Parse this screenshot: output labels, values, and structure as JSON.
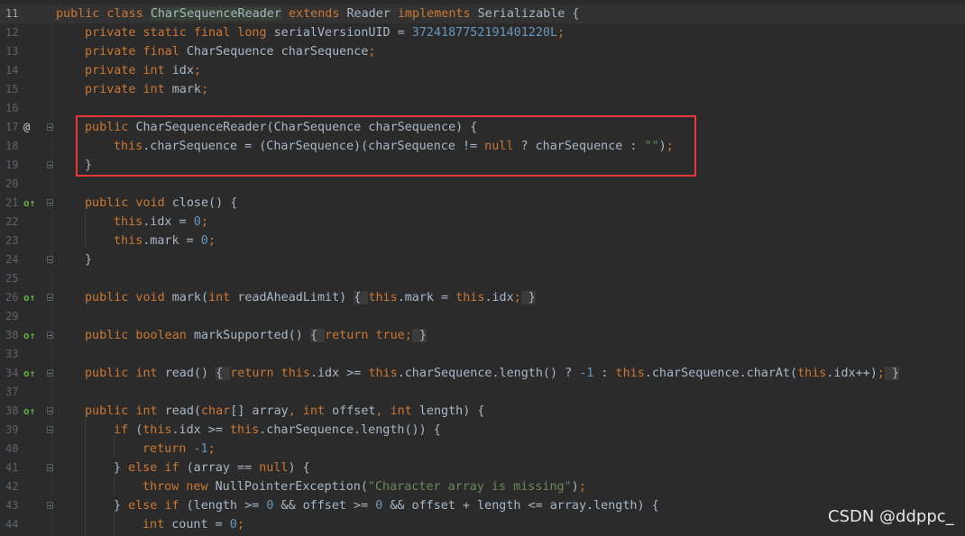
{
  "editor": {
    "line_numbers": [
      "11",
      "12",
      "13",
      "14",
      "15",
      "16",
      "17",
      "18",
      "19",
      "20",
      "21",
      "22",
      "23",
      "24",
      "25",
      "26",
      "29",
      "30",
      "33",
      "34",
      "37",
      "38",
      "39",
      "40",
      "41",
      "42",
      "43",
      "44"
    ],
    "gutter_marks": {
      "17": "@",
      "21": "o↑",
      "26": "o↑",
      "30": "o↑",
      "34": "o↑",
      "38": "o↑"
    },
    "line_11": {
      "t1": "public class ",
      "class_name": "CharSequenceReader",
      "t2": " extends ",
      "t3": "Reader ",
      "t4": "implements ",
      "t5": "Serializable {"
    },
    "line_12": {
      "t1": "private static final long ",
      "t2": "serialVersionUID = ",
      "t3": "3724187752191401220L",
      "t4": ";"
    },
    "line_13": {
      "t1": "private final ",
      "t2": "CharSequence charSequence",
      "t3": ";"
    },
    "line_14": {
      "t1": "private int ",
      "t2": "idx",
      "t3": ";"
    },
    "line_15": {
      "t1": "private int ",
      "t2": "mark",
      "t3": ";"
    },
    "line_17": {
      "t1": "public ",
      "t2": "CharSequenceReader(CharSequence charSequence) {"
    },
    "line_18": {
      "t1": "this",
      "t2": ".charSequence = (CharSequence)(charSequence != ",
      "t3": "null",
      "t4": " ? charSequence : ",
      "t5": "\"\"",
      "t6": ")",
      "t7": ";"
    },
    "line_19": {
      "t1": "}"
    },
    "line_21": {
      "t1": "public void ",
      "t2": "close() {"
    },
    "line_22": {
      "t1": "this",
      "t2": ".idx = ",
      "t3": "0",
      "t4": ";"
    },
    "line_23": {
      "t1": "this",
      "t2": ".mark = ",
      "t3": "0",
      "t4": ";"
    },
    "line_24": {
      "t1": "}"
    },
    "line_26": {
      "t1": "public void ",
      "t2": "mark(",
      "t3": "int ",
      "t4": "readAheadLimit) ",
      "t5": "{ ",
      "t6": "this",
      "t7": ".mark = ",
      "t8": "this",
      "t9": ".idx",
      "t10": ";",
      "t11": " }"
    },
    "line_30": {
      "t1": "public boolean ",
      "t2": "markSupported() ",
      "t3": "{ ",
      "t4": "return true",
      "t5": ";",
      "t6": " }"
    },
    "line_34": {
      "t1": "public int ",
      "t2": "read() ",
      "t3": "{ ",
      "t4": "return this",
      "t5": ".idx >= ",
      "t6": "this",
      "t7": ".charSequence.length() ? ",
      "t8": "-1",
      "t9": " : ",
      "t10": "this",
      "t11": ".charSequence.charAt(",
      "t12": "this",
      "t13": ".idx++)",
      "t14": ";",
      "t15": " }"
    },
    "line_38": {
      "t1": "public int ",
      "t2": "read(",
      "t3": "char",
      "t4": "[] array",
      "t5": ", ",
      "t6": "int ",
      "t7": "offset",
      "t8": ", ",
      "t9": "int ",
      "t10": "length) {"
    },
    "line_39": {
      "t1": "if ",
      "t2": "(",
      "t3": "this",
      "t4": ".idx >= ",
      "t5": "this",
      "t6": ".charSequence.length()) {"
    },
    "line_40": {
      "t1": "return ",
      "t2": "-1",
      "t3": ";"
    },
    "line_41": {
      "t1": "} ",
      "t2": "else if ",
      "t3": "(array == ",
      "t4": "null",
      "t5": ") {"
    },
    "line_42": {
      "t1": "throw new ",
      "t2": "NullPointerException(",
      "t3": "\"Character array is missing\"",
      "t4": ")",
      "t5": ";"
    },
    "line_43": {
      "t1": "} ",
      "t2": "else if ",
      "t3": "(length >= ",
      "t4": "0",
      "t5": " && offset >= ",
      "t6": "0",
      "t7": " && offset + length <= array.length) {"
    },
    "line_44": {
      "t1": "int ",
      "t2": "count = ",
      "t3": "0",
      "t4": ";"
    }
  },
  "colors": {
    "background": "#2b2b2b",
    "keyword": "#cc7832",
    "identifier": "#a9b7c6",
    "number": "#6897bb",
    "string": "#6a8759",
    "highlight_box": "#e8383b"
  },
  "watermark": "CSDN @ddppc_"
}
